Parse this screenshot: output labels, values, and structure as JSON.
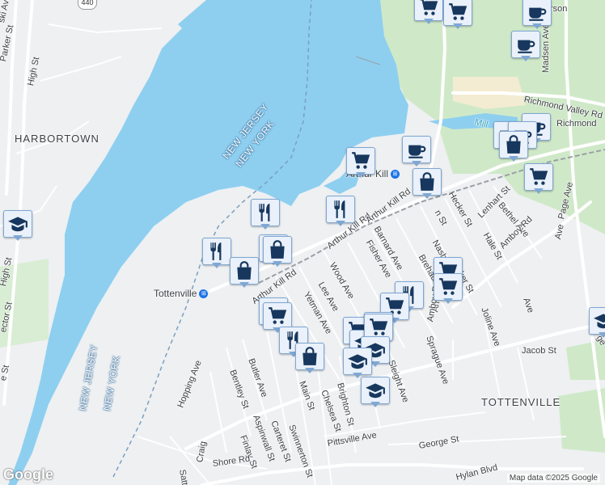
{
  "map": {
    "colors": {
      "water": "#8ecff0",
      "land": "#eef0f2",
      "park": "#cfe9c8",
      "road": "#ffffff",
      "pin_fill": "#eaf1fa",
      "pin_icon": "#17375e",
      "rail": "#38a3b8"
    },
    "area_labels": [
      {
        "id": "harbortown",
        "text": "HARBORTOWN"
      },
      {
        "id": "tottenville",
        "text": "TOTTENVILLE"
      }
    ],
    "water_labels": [
      {
        "id": "nj-ny-top-1",
        "text": "NEW JERSEY"
      },
      {
        "id": "nj-ny-top-2",
        "text": "NEW YORK"
      },
      {
        "id": "nj-ny-bottom-1",
        "text": "NEW JERSEY"
      },
      {
        "id": "nj-ny-bottom-2",
        "text": "NEW YORK"
      }
    ],
    "stations": [
      {
        "id": "arthur-kill",
        "text": "Arthur Kill"
      },
      {
        "id": "tottenville",
        "text": "Tottenville"
      }
    ],
    "streets": [
      "Parker St",
      "High St",
      "ski Ave",
      "Arthur Kill Rd",
      "Arthur Kill Rd",
      "Arthur Kill Rd",
      "Richmond Valley Rd",
      "Richmond",
      "Madsen Ave",
      "Hecker St",
      "Lenhart St",
      "Bethel Ave",
      "Page Ave",
      "Amboy Rd",
      "Amboy Rd",
      "Fisher Ave",
      "Barnard Ave",
      "Wood Ave",
      "Lee Ave",
      "Yetman Ave",
      "Nash",
      "Brehaut",
      "Parker St",
      "Hale St",
      "Joline Ave",
      "Sprague Ave",
      "Jacob St",
      "Butler Ave",
      "Bentley St",
      "Hopping Ave",
      "Main St",
      "Chelsea St",
      "Brighton St",
      "Sleight Ave",
      "Aspinwall St",
      "Carteret St",
      "Swinnerton St",
      "Finlay St",
      "Craig",
      "Satter",
      "Shore Rd",
      "Pittsville Ave",
      "George St",
      "Hylan Blvd",
      "High St",
      "ector St",
      "e St",
      "Mill",
      "n St",
      "Ave",
      "Ave",
      "Amboy Rd",
      "rson",
      "ge",
      "c"
    ],
    "route_shield": "440",
    "pins": [
      {
        "type": "shopping-cart"
      },
      {
        "type": "shopping-cart"
      },
      {
        "type": "coffee"
      },
      {
        "type": "coffee"
      },
      {
        "type": "coffee"
      },
      {
        "type": "coffee"
      },
      {
        "type": "coffee"
      },
      {
        "type": "shopping-bag"
      },
      {
        "type": "shopping-cart"
      },
      {
        "type": "coffee"
      },
      {
        "type": "shopping-cart"
      },
      {
        "type": "shopping-bag"
      },
      {
        "type": "shopping-cart"
      },
      {
        "type": "restaurant"
      },
      {
        "type": "restaurant"
      },
      {
        "type": "shopping-bag"
      },
      {
        "type": "restaurant"
      },
      {
        "type": "shopping-bag"
      },
      {
        "type": "shopping-cart"
      },
      {
        "type": "shopping-bag"
      },
      {
        "type": "shopping-cart"
      },
      {
        "type": "shopping-cart"
      },
      {
        "type": "restaurant"
      },
      {
        "type": "restaurant"
      },
      {
        "type": "shopping-cart"
      },
      {
        "type": "shopping-cart"
      },
      {
        "type": "school"
      },
      {
        "type": "restaurant"
      },
      {
        "type": "shopping-bag"
      },
      {
        "type": "shopping-cart"
      },
      {
        "type": "school"
      },
      {
        "type": "school"
      },
      {
        "type": "school"
      },
      {
        "type": "school"
      },
      {
        "type": "school"
      }
    ],
    "logo": "Google",
    "attribution": "Map data ©2025 Google"
  }
}
